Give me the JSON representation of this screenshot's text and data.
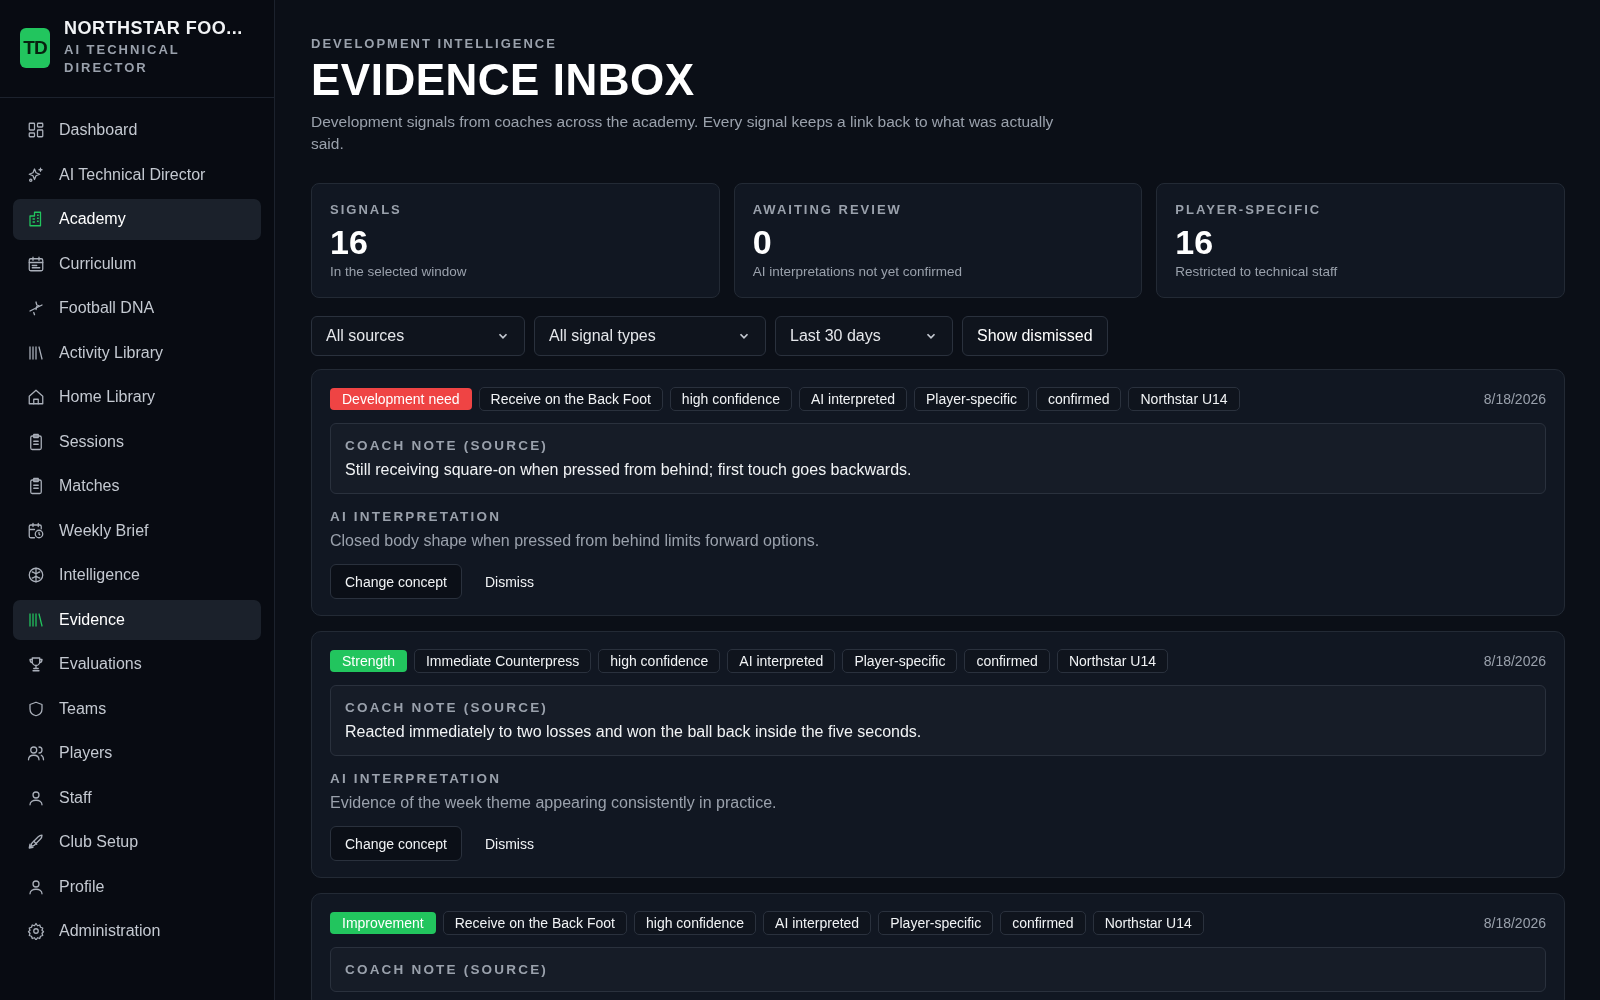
{
  "brand": {
    "logo": "TD",
    "name": "NORTHSTAR FOO...",
    "subtitle": "AI TECHNICAL DIRECTOR"
  },
  "sidebar": {
    "items": [
      {
        "label": "Dashboard",
        "selected": false
      },
      {
        "label": "AI Technical Director",
        "selected": false
      },
      {
        "label": "Academy",
        "selected": true
      },
      {
        "label": "Curriculum",
        "selected": false
      },
      {
        "label": "Football DNA",
        "selected": false
      },
      {
        "label": "Activity Library",
        "selected": false
      },
      {
        "label": "Home Library",
        "selected": false
      },
      {
        "label": "Sessions",
        "selected": false
      },
      {
        "label": "Matches",
        "selected": false
      },
      {
        "label": "Weekly Brief",
        "selected": false
      },
      {
        "label": "Intelligence",
        "selected": false
      },
      {
        "label": "Evidence",
        "selected": true
      },
      {
        "label": "Evaluations",
        "selected": false
      },
      {
        "label": "Teams",
        "selected": false
      },
      {
        "label": "Players",
        "selected": false
      },
      {
        "label": "Staff",
        "selected": false
      },
      {
        "label": "Club Setup",
        "selected": false
      },
      {
        "label": "Profile",
        "selected": false
      },
      {
        "label": "Administration",
        "selected": false
      }
    ]
  },
  "header": {
    "eyebrow": "DEVELOPMENT INTELLIGENCE",
    "title": "EVIDENCE INBOX",
    "description": "Development signals from coaches across the academy. Every signal keeps a link back to what was actually said."
  },
  "stats": [
    {
      "label": "SIGNALS",
      "value": "16",
      "caption": "In the selected window"
    },
    {
      "label": "AWAITING REVIEW",
      "value": "0",
      "caption": "AI interpretations not yet confirmed"
    },
    {
      "label": "PLAYER-SPECIFIC",
      "value": "16",
      "caption": "Restricted to technical staff"
    }
  ],
  "filters": {
    "selects": [
      "All sources",
      "All signal types",
      "Last 30 days"
    ],
    "toggle": "Show dismissed"
  },
  "signals": [
    {
      "type": "Development need",
      "color": "#ef4444",
      "tags": [
        "Receive on the Back Foot",
        "high confidence",
        "AI interpreted",
        "Player-specific",
        "confirmed",
        "Northstar U14"
      ],
      "date": "8/18/2026",
      "note_label": "COACH NOTE (SOURCE)",
      "note": "Still receiving square-on when pressed from behind; first touch goes backwards.",
      "interpretation_label": "AI INTERPRETATION",
      "interpretation": "Closed body shape when pressed from behind limits forward options.",
      "actions": [
        "Change concept",
        "Dismiss"
      ]
    },
    {
      "type": "Strength",
      "color": "#22c55e",
      "tags": [
        "Immediate Counterpress",
        "high confidence",
        "AI interpreted",
        "Player-specific",
        "confirmed",
        "Northstar U14"
      ],
      "date": "8/18/2026",
      "note_label": "COACH NOTE (SOURCE)",
      "note": "Reacted immediately to two losses and won the ball back inside the five seconds.",
      "interpretation_label": "AI INTERPRETATION",
      "interpretation": "Evidence of the week theme appearing consistently in practice.",
      "actions": [
        "Change concept",
        "Dismiss"
      ]
    },
    {
      "type": "Improvement",
      "color": "#22c55e",
      "tags": [
        "Receive on the Back Foot",
        "high confidence",
        "AI interpreted",
        "Player-specific",
        "confirmed",
        "Northstar U14"
      ],
      "date": "8/18/2026",
      "note_label": "COACH NOTE (SOURCE)"
    }
  ]
}
